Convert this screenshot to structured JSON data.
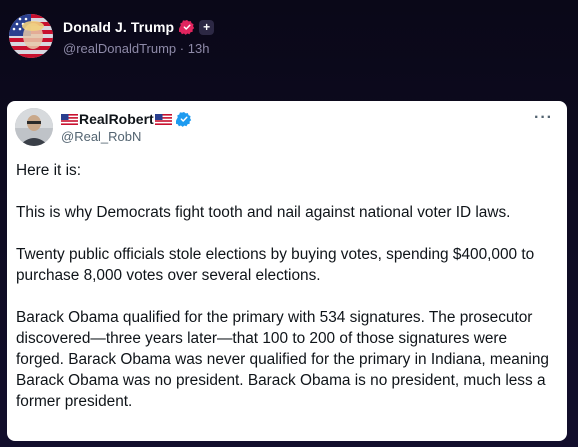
{
  "post": {
    "author_name": "Donald J. Trump",
    "handle": "@realDonaldTrump",
    "separator": "·",
    "time": "13h",
    "verified_color": "#e0245e",
    "plus_icon": "+",
    "avatar_icon": "flag-avatar"
  },
  "card": {
    "author_name": "RealRobert",
    "handle": "@Real_RobN",
    "verified_color": "#1d9bf0",
    "more_icon": "···",
    "flag_icon": "us-flag",
    "paragraphs": [
      "Here it is:",
      "This is why Democrats fight tooth and nail against national voter ID laws.",
      "Twenty public officials stole elections by buying votes, spending $400,000 to purchase 8,000 votes over several elections.",
      "Barack Obama qualified for the primary with 534 signatures. The prosecutor discovered—three years later—that 100 to 200 of those signatures were forged. Barack Obama was never qualified for the primary in Indiana, meaning Barack Obama was no president. Barack Obama is no president, much less a former president."
    ]
  }
}
